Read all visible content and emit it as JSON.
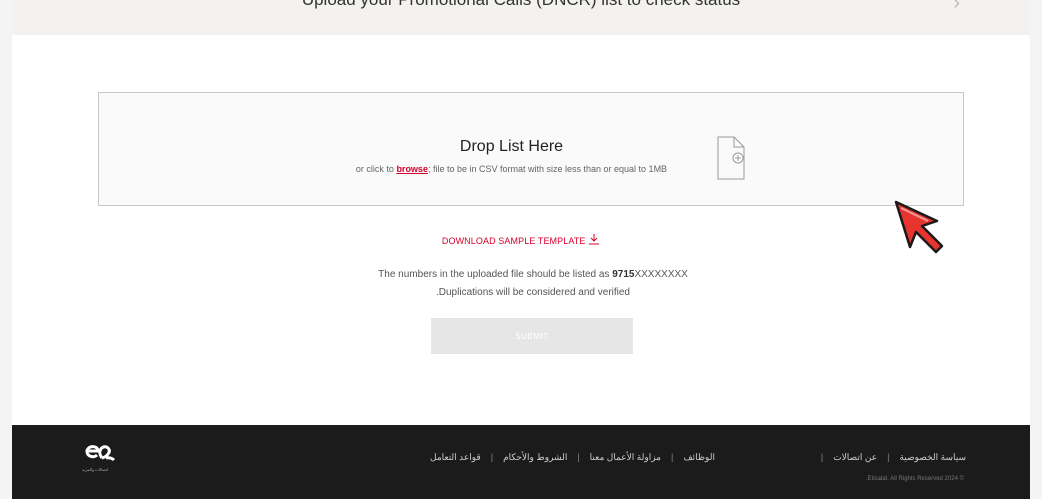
{
  "banner": {
    "title": "Upload your Promotional Calls (DNCR) list to check status",
    "chevron": "›"
  },
  "dropzone": {
    "title": "Drop List Here",
    "sub_prefix": "or click to ",
    "browse_label": "browse",
    "sub_suffix": "; file to be in CSV format with size less than or equal to 1MB",
    "icon": "file-add-icon"
  },
  "download": {
    "label": "DOWNLOAD SAMPLE TEMPLATE",
    "icon": "download-icon"
  },
  "notes": {
    "line1_prefix": "The numbers in the uploaded file should be listed as ",
    "line1_format": "9715",
    "line1_mask": "XXXXXXXX",
    "line2": ".Duplications will be considered and verified"
  },
  "submit": {
    "label": "SUBMIT"
  },
  "footer": {
    "left_links": [
      "الوظائف",
      "مزاولة الأعمال معنا",
      "الشروط والأحكام",
      "قواعد التعامل"
    ],
    "right_links": [
      "سياسة الخصوصية",
      "عن اتصالات"
    ],
    "copyright": ".Etisalat. All Rights Reserved 2024 ©",
    "logo_sub": "اتصالات والمزيد"
  },
  "colors": {
    "accent": "#d8002a",
    "footer_bg": "#1b1b1b",
    "banner_bg": "#f3f2ee"
  }
}
